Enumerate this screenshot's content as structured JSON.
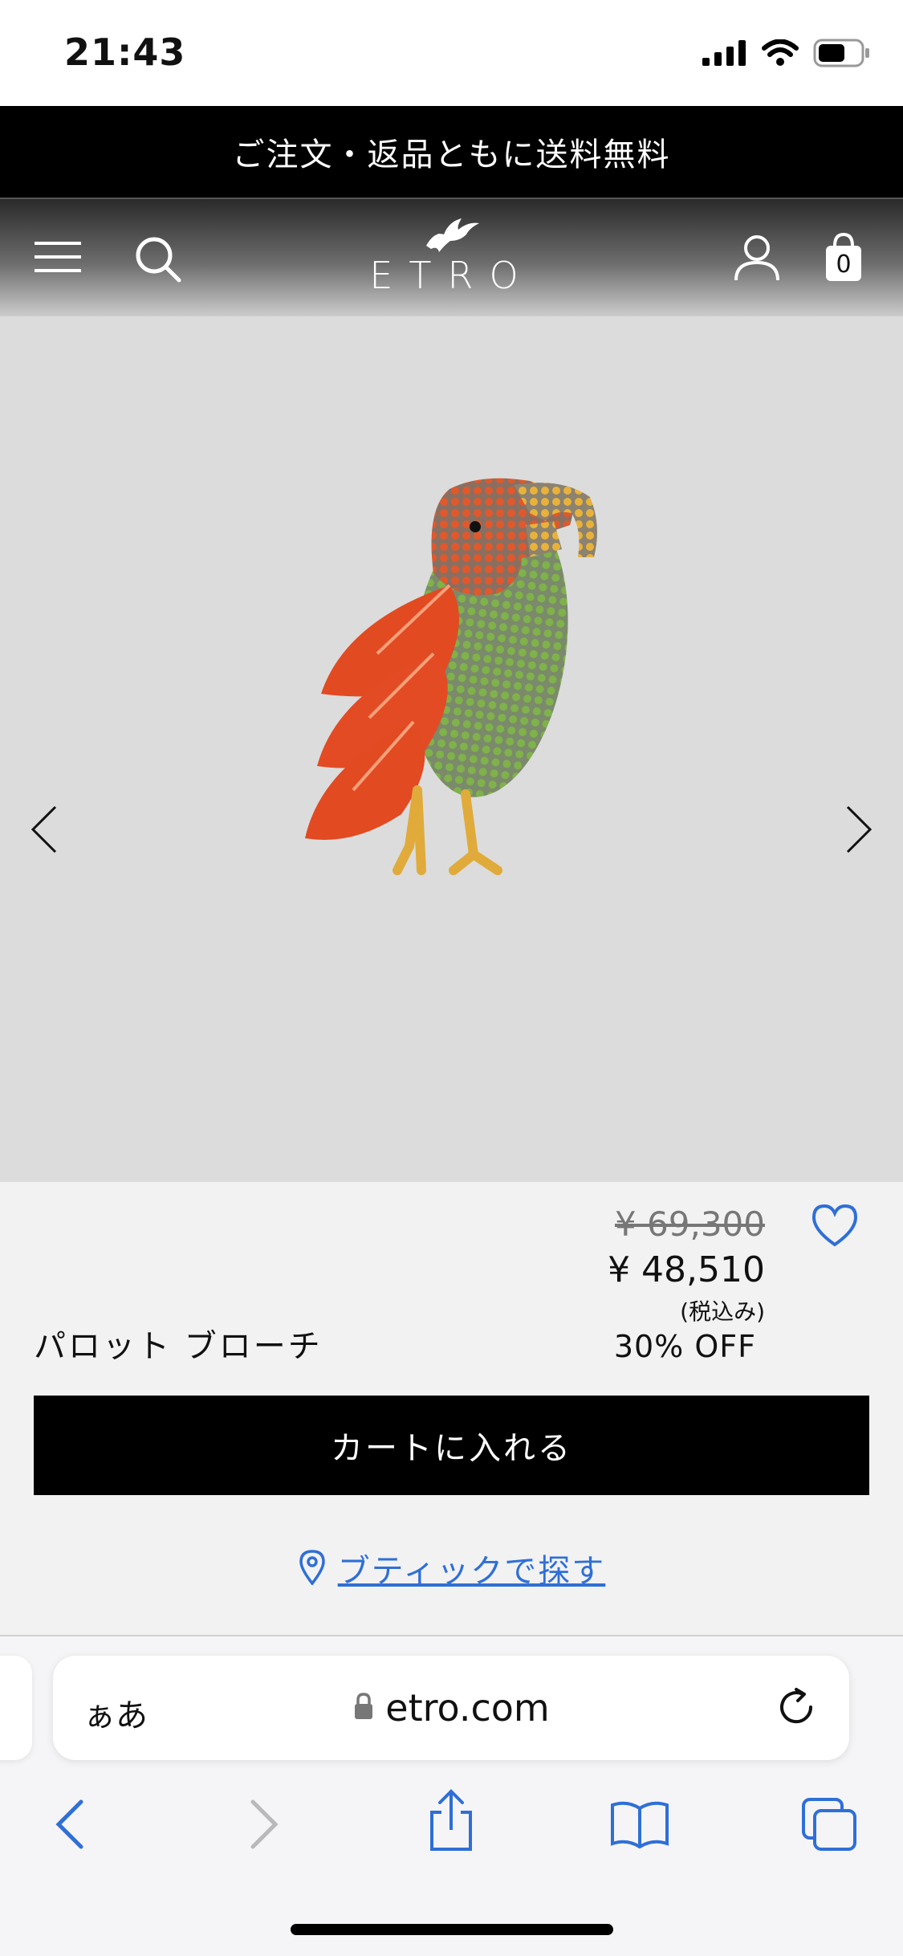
{
  "status_bar": {
    "time": "21:43",
    "icons": [
      "signal-icon",
      "wifi-icon",
      "battery-icon"
    ]
  },
  "promo_banner": {
    "text": "ご注文・返品ともに送料無料"
  },
  "header": {
    "icons": [
      "menu-icon",
      "search-icon",
      "account-icon",
      "shopping-bag-icon"
    ],
    "logo_text": "ETRO",
    "cart_count": "0"
  },
  "product": {
    "name": "パロット ブローチ",
    "original_price": "¥ 69,300",
    "sale_price": "¥ 48,510",
    "tax_note": "(税込み)",
    "discount": "30% OFF",
    "add_to_cart": "カートに入れる",
    "store_link": "ブティックで探す"
  },
  "browser": {
    "text_size_label": "ぁあ",
    "url": "etro.com",
    "toolbar": [
      "back-icon",
      "forward-icon",
      "share-icon",
      "bookmarks-icon",
      "tabs-icon"
    ]
  },
  "colors": {
    "link": "#2f6fd6",
    "banner": "#000000",
    "image_bg": "#dcdcdc",
    "heart": "#2f6fd6"
  }
}
